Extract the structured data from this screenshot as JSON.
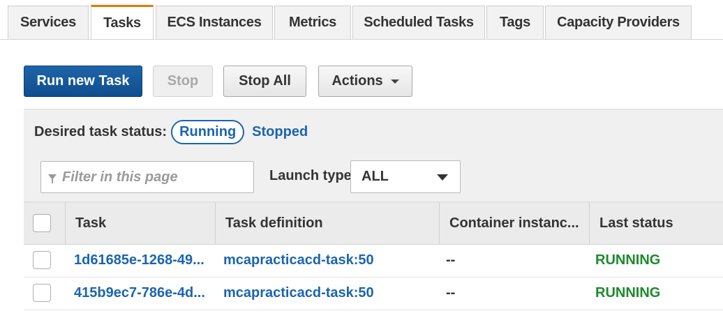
{
  "tabs": [
    {
      "label": "Services",
      "active": false
    },
    {
      "label": "Tasks",
      "active": true
    },
    {
      "label": "ECS Instances",
      "active": false
    },
    {
      "label": "Metrics",
      "active": false
    },
    {
      "label": "Scheduled Tasks",
      "active": false
    },
    {
      "label": "Tags",
      "active": false
    },
    {
      "label": "Capacity Providers",
      "active": false
    }
  ],
  "toolbar": {
    "run_new_task": "Run new Task",
    "stop": "Stop",
    "stop_all": "Stop All",
    "actions": "Actions"
  },
  "filters": {
    "desired_status_label": "Desired task status:",
    "status_running": "Running",
    "status_stopped": "Stopped",
    "filter_placeholder": "Filter in this page",
    "launch_type_label": "Launch type",
    "launch_type_value": "ALL"
  },
  "table": {
    "columns": [
      "Task",
      "Task definition",
      "Container instanc...",
      "Last status"
    ],
    "rows": [
      {
        "task": "1d61685e-1268-49...",
        "definition": "mcapracticacd-task:50",
        "container": "--",
        "status": "RUNNING"
      },
      {
        "task": "415b9ec7-786e-4d...",
        "definition": "mcapracticacd-task:50",
        "container": "--",
        "status": "RUNNING"
      }
    ]
  },
  "colors": {
    "accent_tab": "#e07b00",
    "primary_button": "#1a5ea3",
    "link": "#1b64b0",
    "running": "#1d8a2e"
  }
}
